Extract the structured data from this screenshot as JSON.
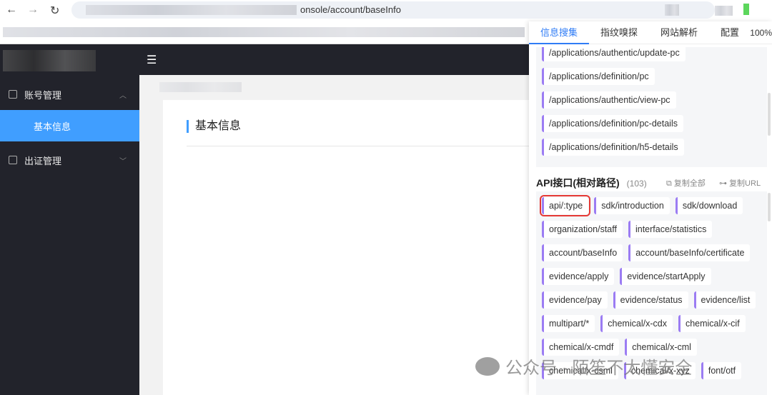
{
  "browser": {
    "url_visible": "onsole/account/baseInfo"
  },
  "sidebar": {
    "items": [
      {
        "label": "账号管理"
      },
      {
        "label": "基本信息"
      },
      {
        "label": "出证管理"
      }
    ]
  },
  "content": {
    "title": "基本信息"
  },
  "panel": {
    "tabs": [
      "信息搜集",
      "指纹嗅探",
      "网站解析",
      "配置"
    ],
    "zoom": "100%",
    "paths": [
      "/applications/authentic/update-pc",
      "/applications/definition/pc",
      "/applications/authentic/view-pc",
      "/applications/definition/pc-details",
      "/applications/definition/h5-details"
    ],
    "api_title": "API接口(相对路径)",
    "api_count": "(103)",
    "copy_all": "复制全部",
    "copy_url": "复制URL",
    "api_rows": [
      [
        "api/:type",
        "sdk/introduction",
        "sdk/download"
      ],
      [
        "organization/staff",
        "interface/statistics"
      ],
      [
        "account/baseInfo",
        "account/baseInfo/certificate"
      ],
      [
        "evidence/apply",
        "evidence/startApply"
      ],
      [
        "evidence/pay",
        "evidence/status",
        "evidence/list"
      ],
      [
        "multipart/*",
        "chemical/x-cdx",
        "chemical/x-cif"
      ],
      [
        "chemical/x-cmdf",
        "chemical/x-cml"
      ],
      [
        "chemical/x-csml",
        "chemical/x-xyz",
        "font/otf"
      ]
    ]
  },
  "watermark": "公众号 · 陌笙不太懂安全"
}
